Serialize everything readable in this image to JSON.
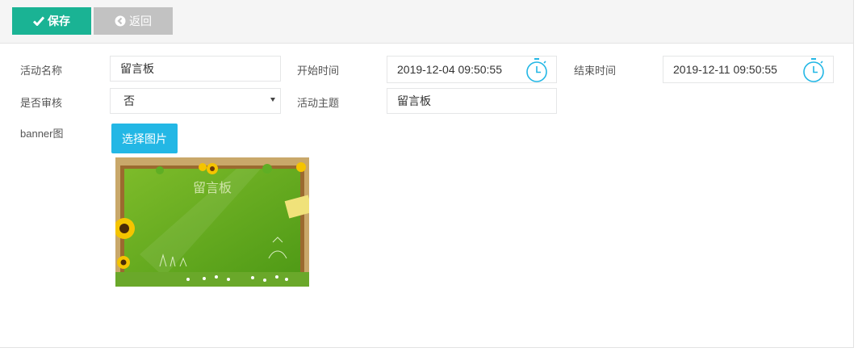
{
  "toolbar": {
    "save_label": "保存",
    "back_label": "返回"
  },
  "form": {
    "activity_name_label": "活动名称",
    "activity_name_value": "留言板",
    "start_time_label": "开始时间",
    "start_time_value": "2019-12-04 09:50:55",
    "end_time_label": "结束时间",
    "end_time_value": "2019-12-11 09:50:55",
    "audit_label": "是否审核",
    "audit_value": "否",
    "theme_label": "活动主题",
    "theme_value": "留言板",
    "banner_label": "banner图",
    "choose_image_label": "选择图片",
    "banner_image_text": "留言板"
  },
  "colors": {
    "save": "#1ab394",
    "back": "#c2c2c2",
    "choose": "#23b7e5",
    "clock": "#23b7e5"
  }
}
